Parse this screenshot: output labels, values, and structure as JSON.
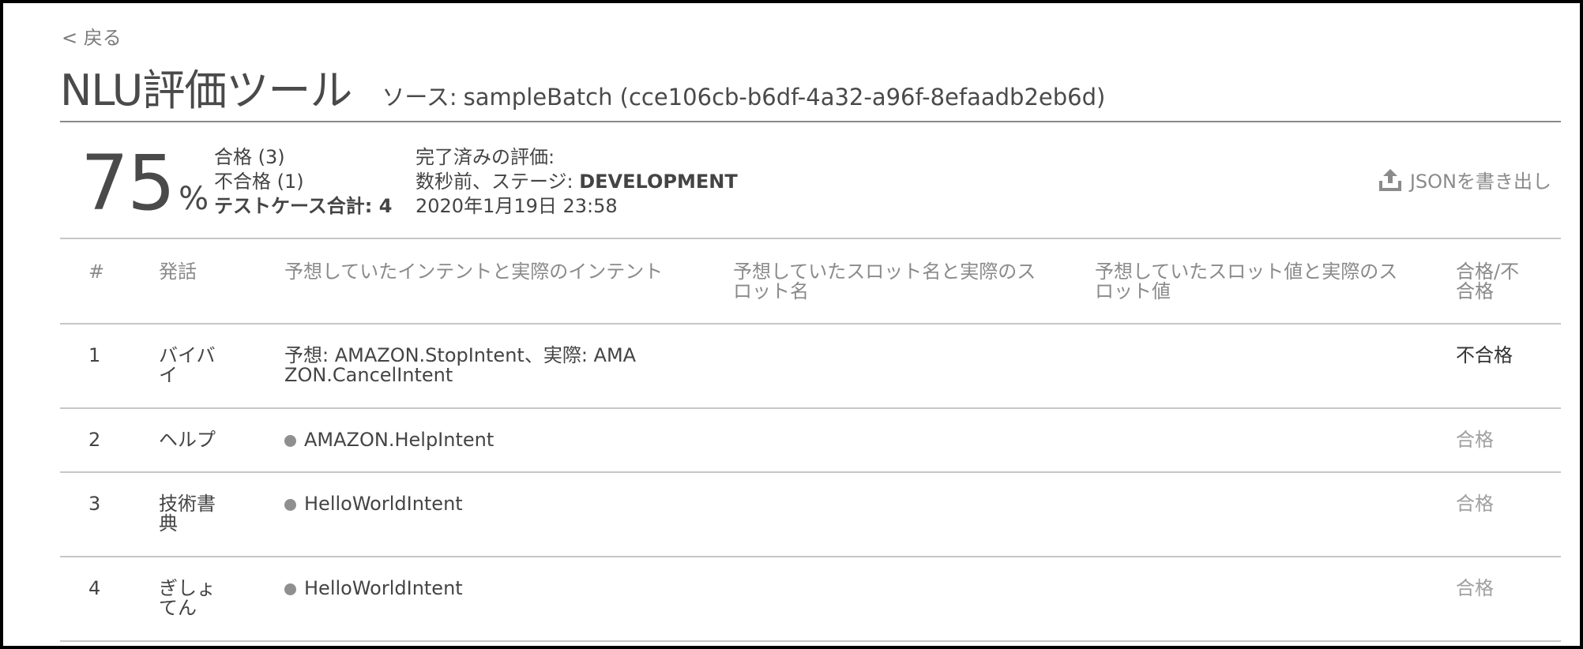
{
  "nav": {
    "back_label": "< 戻る"
  },
  "header": {
    "title": "NLU評価ツール",
    "source_prefix": "ソース:",
    "source_value": "sampleBatch (cce106cb-b6df-4a32-a96f-8efaadb2eb6d)"
  },
  "summary": {
    "score": "75",
    "score_unit": "%",
    "pass_count": "合格 (3)",
    "fail_count": "不合格 (1)",
    "total_label": "テストケース合計: 4",
    "eval_label": "完了済みの評価:",
    "eval_stage_prefix": "数秒前、ステージ: ",
    "eval_stage": "DEVELOPMENT",
    "eval_datetime": "2020年1月19日 23:58"
  },
  "toolbar": {
    "export_label": "JSONを書き出し",
    "export_icon": "upload-icon"
  },
  "table": {
    "headers": [
      "#",
      "発話",
      "予想していたインテントと実際のインテント",
      "予想していたスロット名と実際のスロット名",
      "予想していたスロット値と実際のスロット値",
      "合格/不合格"
    ],
    "rows": [
      {
        "num": "1",
        "utterance": "バイバイ",
        "intent": "予想: AMAZON.StopIntent、実際: AMAZON.CancelIntent",
        "slot_name": "",
        "slot_value": "",
        "result": "不合格"
      },
      {
        "num": "2",
        "utterance": "ヘルプ",
        "intent": "AMAZON.HelpIntent",
        "slot_name": "",
        "slot_value": "",
        "result": "合格"
      },
      {
        "num": "3",
        "utterance": "技術書典",
        "intent": "HelloWorldIntent",
        "slot_name": "",
        "slot_value": "",
        "result": "合格"
      },
      {
        "num": "4",
        "utterance": "ぎしょてん",
        "intent": "HelloWorldIntent",
        "slot_name": "",
        "slot_value": "",
        "result": "合格"
      }
    ]
  },
  "colors": {
    "text_primary": "#444444",
    "text_muted": "#8a8a8a",
    "pass": "#a0a0a0",
    "divider": "#c6c6c6"
  }
}
